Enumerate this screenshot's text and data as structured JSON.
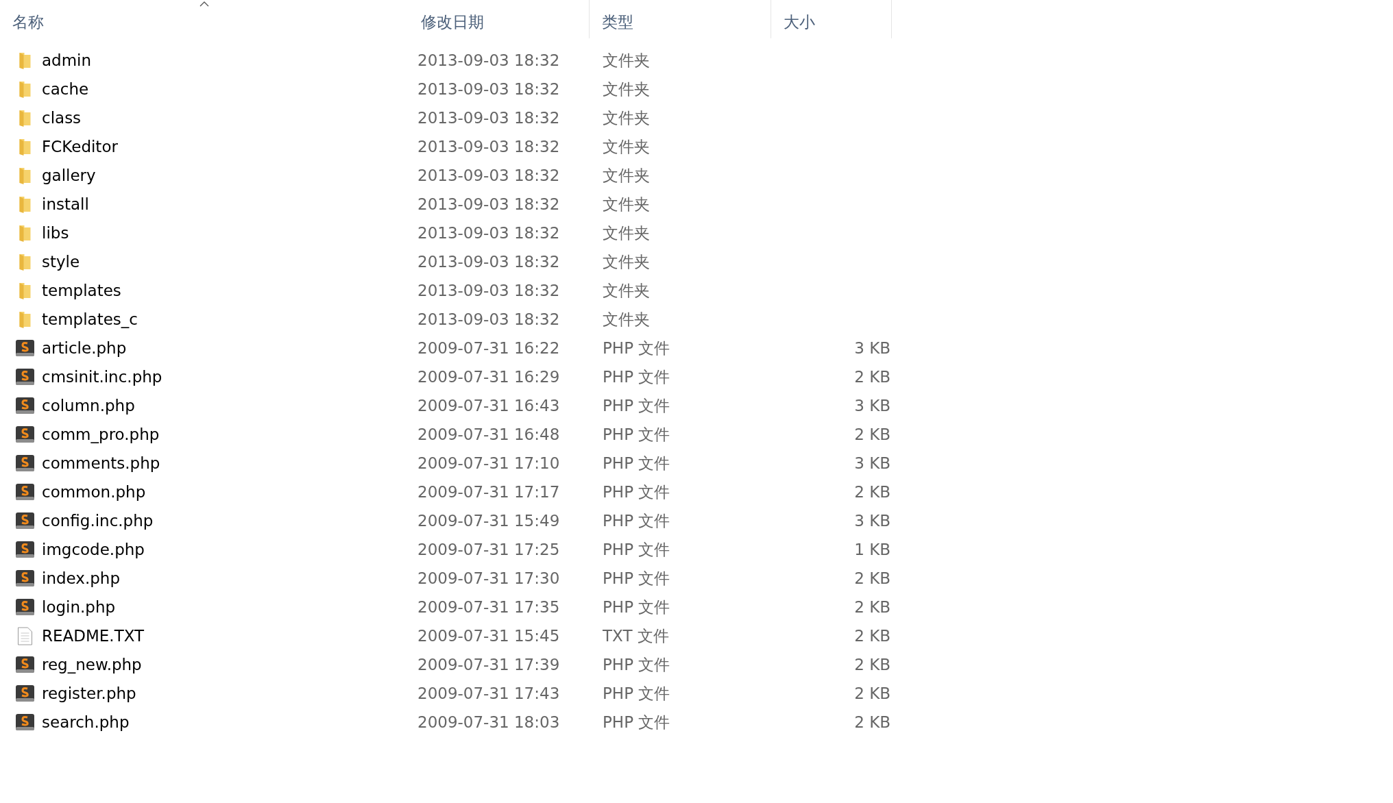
{
  "columns": [
    {
      "label": "名称",
      "sorted": true
    },
    {
      "label": "修改日期",
      "sorted": false
    },
    {
      "label": "类型",
      "sorted": false
    },
    {
      "label": "大小",
      "sorted": false
    }
  ],
  "files": [
    {
      "name": "admin",
      "modified": "2013-09-03 18:32",
      "type": "文件夹",
      "kind": "folder"
    },
    {
      "name": "cache",
      "modified": "2013-09-03 18:32",
      "type": "文件夹",
      "kind": "folder"
    },
    {
      "name": "class",
      "modified": "2013-09-03 18:32",
      "type": "文件夹",
      "kind": "folder"
    },
    {
      "name": "FCKeditor",
      "modified": "2013-09-03 18:32",
      "type": "文件夹",
      "kind": "folder"
    },
    {
      "name": "gallery",
      "modified": "2013-09-03 18:32",
      "type": "文件夹",
      "kind": "folder"
    },
    {
      "name": "install",
      "modified": "2013-09-03 18:32",
      "type": "文件夹",
      "kind": "folder"
    },
    {
      "name": "libs",
      "modified": "2013-09-03 18:32",
      "type": "文件夹",
      "kind": "folder"
    },
    {
      "name": "style",
      "modified": "2013-09-03 18:32",
      "type": "文件夹",
      "kind": "folder"
    },
    {
      "name": "templates",
      "modified": "2013-09-03 18:32",
      "type": "文件夹",
      "kind": "folder"
    },
    {
      "name": "templates_c",
      "modified": "2013-09-03 18:32",
      "type": "文件夹",
      "kind": "folder"
    },
    {
      "name": "article.php",
      "modified": "2009-07-31 16:22",
      "type": "PHP 文件",
      "size": "3 KB",
      "kind": "php"
    },
    {
      "name": "cmsinit.inc.php",
      "modified": "2009-07-31 16:29",
      "type": "PHP 文件",
      "size": "2 KB",
      "kind": "php"
    },
    {
      "name": "column.php",
      "modified": "2009-07-31 16:43",
      "type": "PHP 文件",
      "size": "3 KB",
      "kind": "php"
    },
    {
      "name": "comm_pro.php",
      "modified": "2009-07-31 16:48",
      "type": "PHP 文件",
      "size": "2 KB",
      "kind": "php"
    },
    {
      "name": "comments.php",
      "modified": "2009-07-31 17:10",
      "type": "PHP 文件",
      "size": "3 KB",
      "kind": "php"
    },
    {
      "name": "common.php",
      "modified": "2009-07-31 17:17",
      "type": "PHP 文件",
      "size": "2 KB",
      "kind": "php"
    },
    {
      "name": "config.inc.php",
      "modified": "2009-07-31 15:49",
      "type": "PHP 文件",
      "size": "3 KB",
      "kind": "php"
    },
    {
      "name": "imgcode.php",
      "modified": "2009-07-31 17:25",
      "type": "PHP 文件",
      "size": "1 KB",
      "kind": "php"
    },
    {
      "name": "index.php",
      "modified": "2009-07-31 17:30",
      "type": "PHP 文件",
      "size": "2 KB",
      "kind": "php"
    },
    {
      "name": "login.php",
      "modified": "2009-07-31 17:35",
      "type": "PHP 文件",
      "size": "2 KB",
      "kind": "php"
    },
    {
      "name": "README.TXT",
      "modified": "2009-07-31 15:45",
      "type": "TXT 文件",
      "size": "2 KB",
      "kind": "txt"
    },
    {
      "name": "reg_new.php",
      "modified": "2009-07-31 17:39",
      "type": "PHP 文件",
      "size": "2 KB",
      "kind": "php"
    },
    {
      "name": "register.php",
      "modified": "2009-07-31 17:43",
      "type": "PHP 文件",
      "size": "2 KB",
      "kind": "php"
    },
    {
      "name": "search.php",
      "modified": "2009-07-31 18:03",
      "type": "PHP 文件",
      "size": "2 KB",
      "kind": "php"
    }
  ]
}
